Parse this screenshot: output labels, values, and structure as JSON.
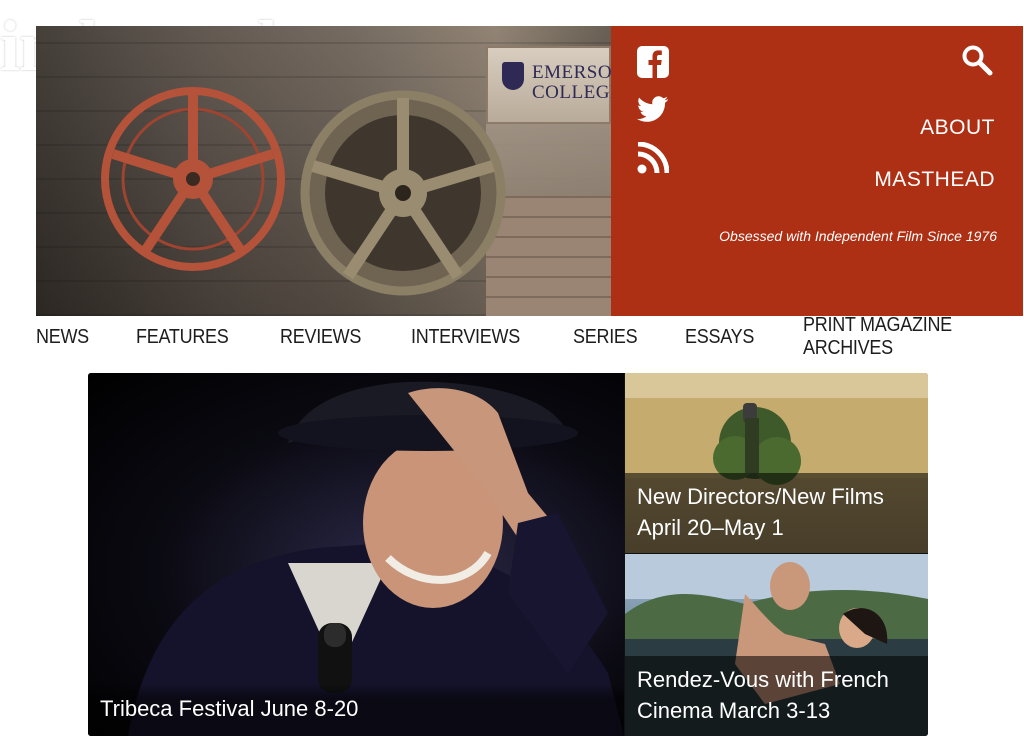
{
  "logo": {
    "the": "THE",
    "word": "independent"
  },
  "hero": {
    "sponsor_line1": "EMERSON",
    "sponsor_line2": "COLLEGE"
  },
  "header": {
    "about_label": "ABOUT",
    "masthead_label": "MASTHEAD",
    "tagline": "Obsessed with Independent Film Since 1976",
    "social_icons": [
      "facebook-icon",
      "twitter-icon",
      "rss-icon"
    ],
    "search_icon": "search-icon",
    "accent_color": "#ad2f14"
  },
  "nav": {
    "items": [
      {
        "label": "NEWS"
      },
      {
        "label": "FEATURES"
      },
      {
        "label": "REVIEWS"
      },
      {
        "label": "INTERVIEWS"
      },
      {
        "label": "SERIES"
      },
      {
        "label": "ESSAYS"
      },
      {
        "label": "PRINT MAGAZINE ARCHIVES"
      }
    ]
  },
  "features": {
    "main": {
      "title": "Tribeca Festival June 8-20"
    },
    "side": [
      {
        "title": "New Directors/New Films April 20–May 1"
      },
      {
        "title": "Rendez-Vous with French Cinema March 3-13"
      }
    ]
  }
}
